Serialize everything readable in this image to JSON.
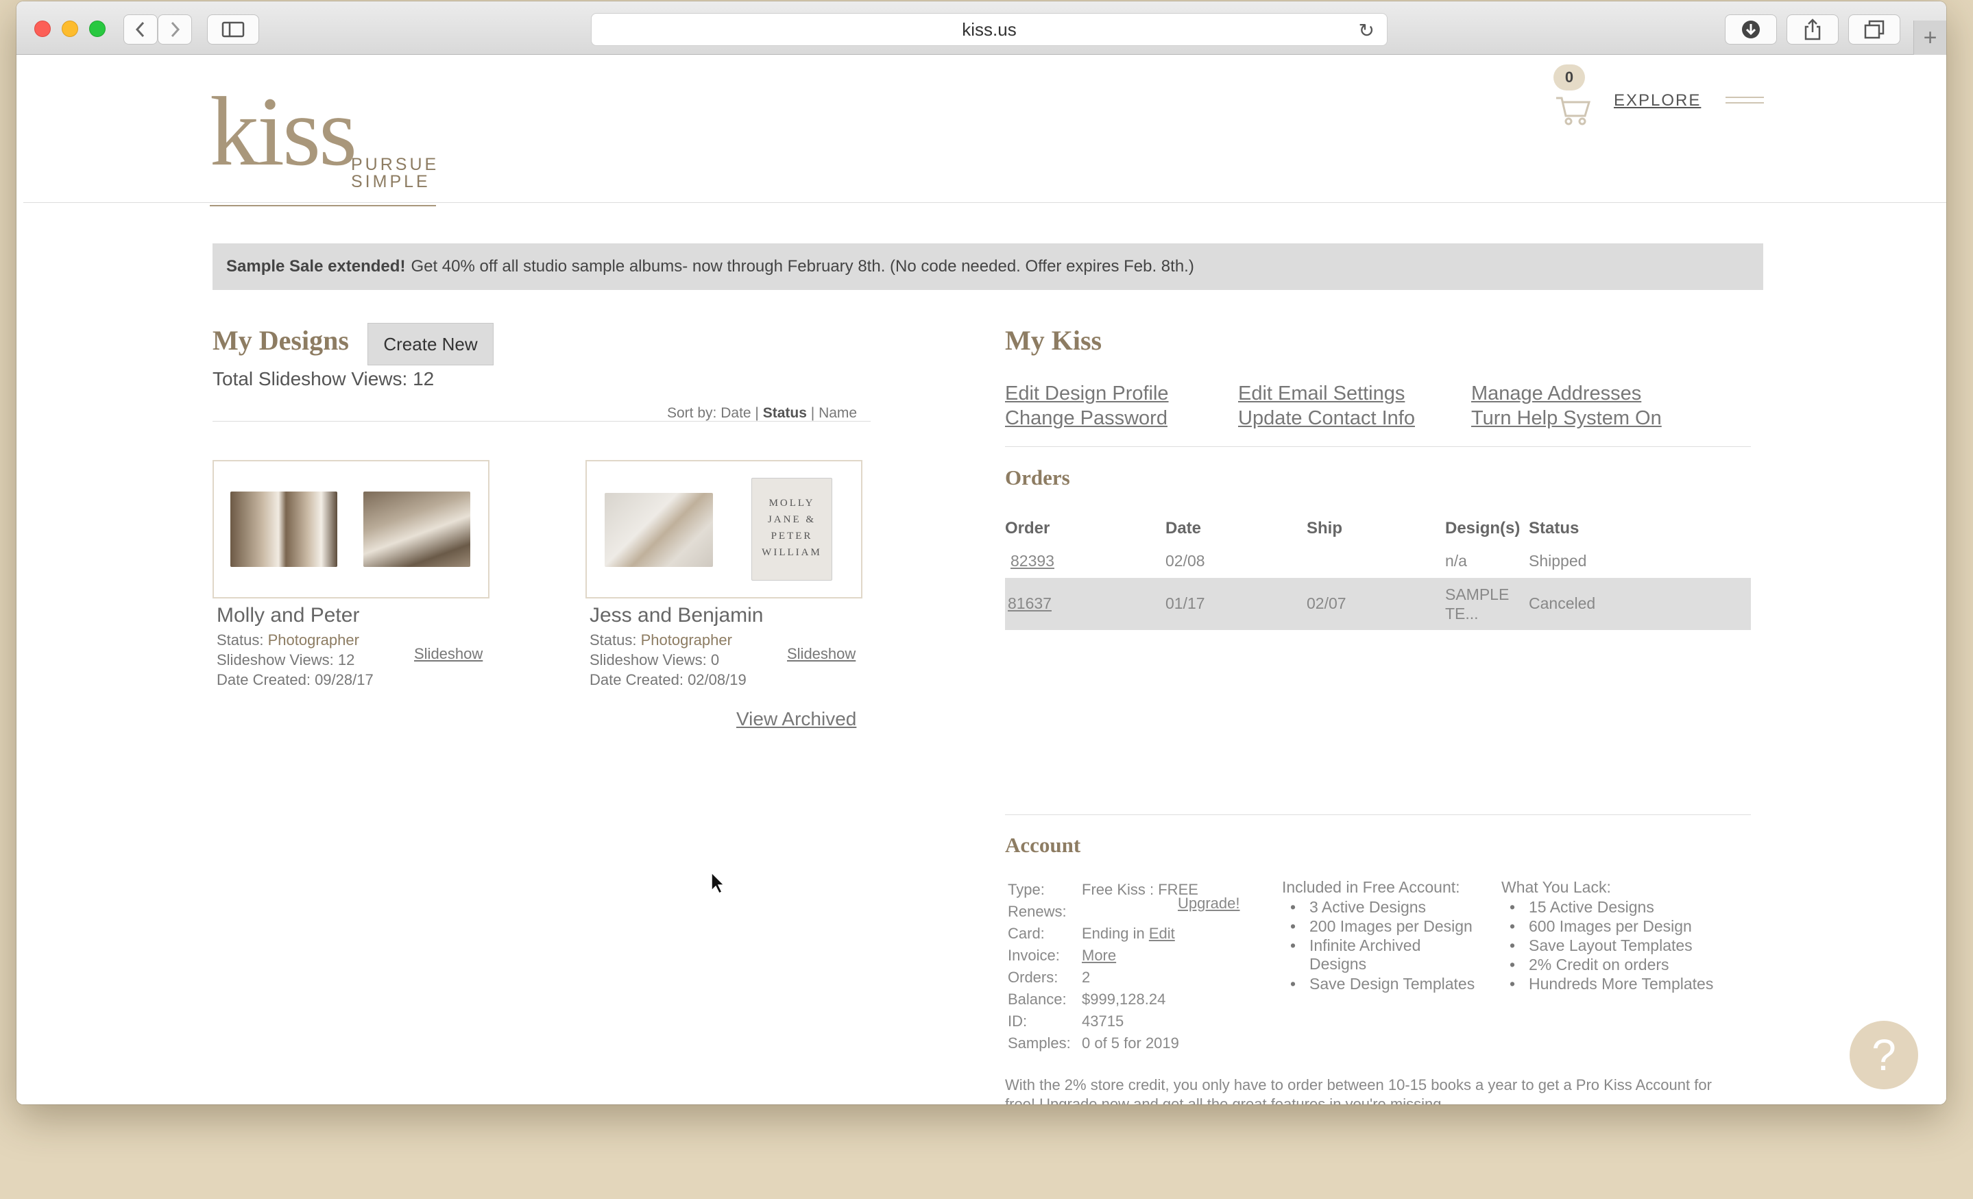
{
  "browser": {
    "url": "kiss.us"
  },
  "header": {
    "logo_main": "kiss",
    "logo_word1": "PURSUE",
    "logo_word2": "SIMPLE",
    "cart_count": "0",
    "explore_label": "EXPLORE"
  },
  "banner": {
    "bold": "Sample Sale extended!",
    "text": "Get 40% off all studio sample albums- now through February 8th. (No code needed. Offer expires Feb. 8th.)"
  },
  "designs": {
    "title": "My Designs",
    "create_new": "Create New",
    "total_views": "Total Slideshow Views: 12",
    "sort_prefix": "Sort by:",
    "sort_date": "Date",
    "sort_status": "Status",
    "sort_name": "Name",
    "sep": "|",
    "cards": [
      {
        "title": "Molly and Peter",
        "status_label": "Status:",
        "status_value": "Photographer",
        "views": "Slideshow Views: 12",
        "created": "Date Created: 09/28/17",
        "slideshow": "Slideshow"
      },
      {
        "title": "Jess and Benjamin",
        "status_label": "Status:",
        "status_value": "Photographer",
        "views": "Slideshow Views: 0",
        "created": "Date Created: 02/08/19",
        "slideshow": "Slideshow"
      }
    ],
    "view_archived": "View Archived",
    "card2_text": "MOLLY JANE & PETER WILLIAM"
  },
  "mykiss": {
    "title": "My Kiss",
    "links": [
      "Edit Design Profile",
      "Change Password",
      "Edit Email Settings",
      "Update Contact Info",
      "Manage Addresses",
      "Turn Help System On"
    ]
  },
  "orders": {
    "title": "Orders",
    "headers": [
      "Order",
      "Date",
      "Ship",
      "Design(s)",
      "Status"
    ],
    "rows": [
      {
        "order": "82393",
        "date": "02/08",
        "ship": "",
        "design": "n/a",
        "status": "Shipped"
      },
      {
        "order": "81637",
        "date": "01/17",
        "ship": "02/07",
        "design": "SAMPLE TE...",
        "status": "Canceled"
      }
    ]
  },
  "account": {
    "title": "Account",
    "labels": [
      "Type:",
      "Renews:",
      "Card:",
      "Invoice:",
      "Orders:",
      "Balance:",
      "ID:",
      "Samples:"
    ],
    "type": "Free Kiss : FREE",
    "upgrade": "Upgrade!",
    "card_prefix": "Ending in",
    "card_edit": "Edit",
    "invoice": "More",
    "orders": "2",
    "balance": "$999,128.24",
    "id": "43715",
    "samples": "0 of 5 for 2019",
    "included_title": "Included in Free Account:",
    "included": [
      "3 Active Designs",
      "200 Images per Design",
      "Infinite Archived",
      "Designs",
      "Save Design Templates"
    ],
    "lack_title": "What You Lack:",
    "lack": [
      "15 Active Designs",
      "600 Images per Design",
      "Save Layout Templates",
      "2% Credit on orders",
      "Hundreds More Templates"
    ],
    "footer": "With the 2% store credit, you only have to order between 10-15 books a year to get a Pro Kiss Account for free! Upgrade now and get all the great features in you're missing"
  },
  "help": {
    "label": "?"
  },
  "colors": {
    "desktop": "#e3d6bb",
    "brand": "#a9977b",
    "banner_bg": "#dcdcdc"
  }
}
